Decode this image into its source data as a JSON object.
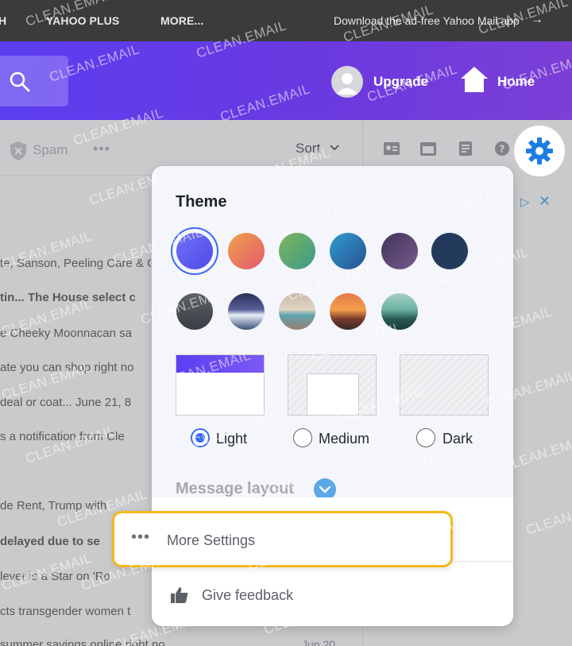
{
  "topnav": {
    "links": [
      "H",
      "YAHOO PLUS",
      "MORE..."
    ],
    "promo": "Download the ad-free Yahoo Mail app",
    "promo_arrow": "→"
  },
  "header": {
    "upgrade_label": "Upgrade",
    "home_label": "Home"
  },
  "toolbar": {
    "spam_label": "Spam",
    "more_label": "•••",
    "sort_label": "Sort"
  },
  "messages": [
    "te, Sanson, Peeling Care & Gam",
    "tin...   The House select c",
    "e Cheeky Moonnacan sa",
    "ate you can shop right no",
    "deal or coat...  June 21, 8",
    "s a notification from Cle",
    "",
    "de Rent, Trump with",
    "delayed due to se",
    "lever is a Star on 'Ro",
    "cts transgender women t",
    "summer savings online right no"
  ],
  "message_date": "Jun 20",
  "settings": {
    "theme_title": "Theme",
    "swatch_colors": [
      "#5b5bf8",
      "#e9894b",
      "#5aa86a",
      "#2f7fb5",
      "#5a4a78",
      "#243a5c"
    ],
    "density": [
      {
        "label": "Light",
        "selected": true
      },
      {
        "label": "Medium",
        "selected": false
      },
      {
        "label": "Dark",
        "selected": false
      }
    ],
    "layout_title": "Message layout",
    "more_settings_label": "More Settings",
    "more_settings_dots": "•••",
    "feedback_label": "Give feedback"
  },
  "watermark": "CLEAN.EMAIL",
  "colors": {
    "accent": "#3b6bf5",
    "highlight": "#f4b81c",
    "header_purple": "#5b3ef0"
  }
}
